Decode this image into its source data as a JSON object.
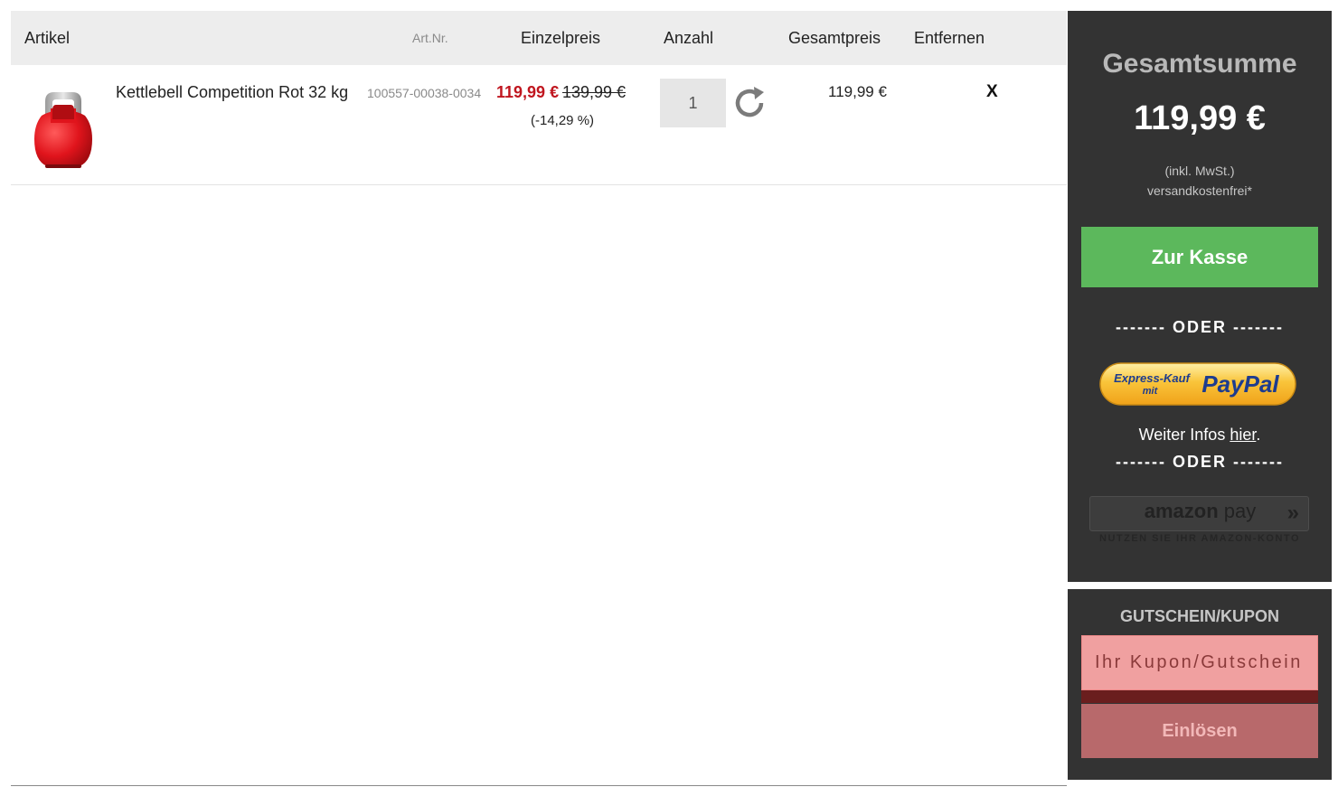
{
  "table": {
    "headers": {
      "article": "Artikel",
      "art_nr": "Art.Nr.",
      "unit_price": "Einzelpreis",
      "quantity": "Anzahl",
      "total_price": "Gesamtpreis",
      "remove": "Entfernen"
    },
    "rows": [
      {
        "name": "Kettlebell Competition Rot 32 kg",
        "art_nr": "100557-00038-0034",
        "price_new": "119,99 €",
        "price_old": "139,99 €",
        "discount": "(-14,29 %)",
        "quantity": "1",
        "total": "119,99 €",
        "remove_label": "X"
      }
    ]
  },
  "summary": {
    "title": "Gesamtsumme",
    "amount": "119,99 €",
    "note_vat": "(inkl. MwSt.)",
    "note_shipping": "versandkostenfrei*",
    "checkout_label": "Zur Kasse",
    "or_label_1": "------- ODER -------",
    "paypal_express": "Express-Kauf",
    "paypal_mit": "mit",
    "paypal_brand": "PayPal",
    "info_prefix": "Weiter Infos ",
    "info_link": "hier",
    "info_suffix": ".",
    "or_label_2": "------- ODER -------",
    "amazon_brand": "amazon",
    "amazon_pay": "pay",
    "amazon_arrows": "»",
    "amazon_sub": "NUTZEN SIE IHR AMAZON-KONTO"
  },
  "coupon": {
    "title": "GUTSCHEIN/KUPON",
    "placeholder": "Ihr Kupon/Gutschein",
    "redeem_label": "Einlösen"
  },
  "colors": {
    "accent_green": "#5cb85c",
    "sale_red": "#c0161f",
    "sidebar_bg": "#333333",
    "paypal_yellow": "#f7b733",
    "paypal_blue": "#1d3c8f"
  }
}
